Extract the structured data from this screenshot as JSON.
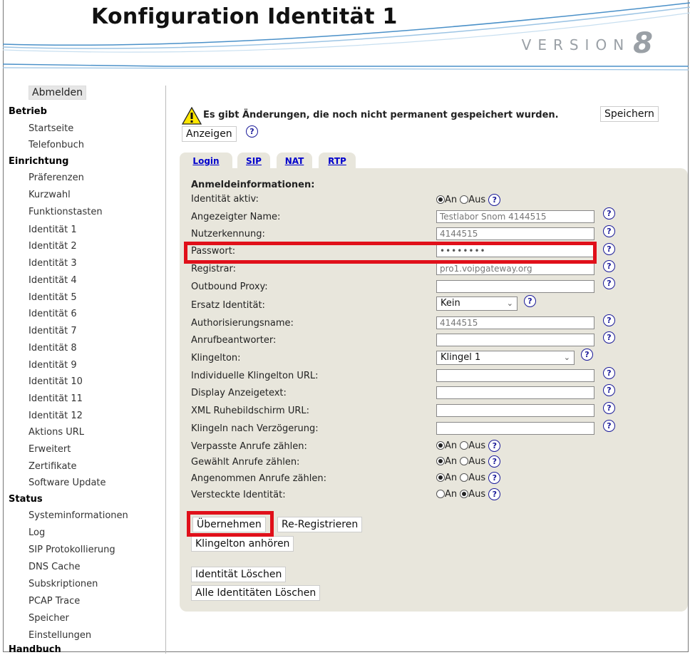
{
  "header": {
    "title": "Konfiguration Identität 1",
    "version_label": "VERSION",
    "version_number": "8"
  },
  "sidebar": {
    "logout": "Abmelden",
    "sections": [
      {
        "title": "Betrieb",
        "items": [
          "Startseite",
          "Telefonbuch"
        ]
      },
      {
        "title": "Einrichtung",
        "items": [
          "Präferenzen",
          "Kurzwahl",
          "Funktionstasten",
          "Identität 1",
          "Identität 2",
          "Identität 3",
          "Identität 4",
          "Identität 5",
          "Identität 6",
          "Identität 7",
          "Identität 8",
          "Identität 9",
          "Identität 10",
          "Identität 11",
          "Identität 12",
          "Aktions URL",
          "Erweitert",
          "Zertifikate",
          "Software Update"
        ]
      },
      {
        "title": "Status",
        "items": [
          "Systeminformationen",
          "Log",
          "SIP Protokollierung",
          "DNS Cache",
          "Subskriptionen",
          "PCAP Trace",
          "Speicher",
          "Einstellungen"
        ]
      },
      {
        "title": "Handbuch",
        "items": []
      }
    ]
  },
  "warning": {
    "text": "Es gibt Änderungen, die noch nicht permanent gespeichert wurden.",
    "save_button": "Speichern",
    "show_button": "Anzeigen"
  },
  "tabs": [
    "Login",
    "SIP",
    "NAT",
    "RTP"
  ],
  "form": {
    "section_title": "Anmeldeinformationen:",
    "radio_on": "An",
    "radio_off": "Aus",
    "fields": {
      "identity_active": {
        "label": "Identität aktiv:",
        "value": "An"
      },
      "display_name": {
        "label": "Angezeigter Name:",
        "value": "Testlabor Snom 4144515"
      },
      "user_id": {
        "label": "Nutzerkennung:",
        "value": "4144515"
      },
      "password": {
        "label": "Passwort:",
        "value": "••••••••"
      },
      "registrar": {
        "label": "Registrar:",
        "value": "pro1.voipgateway.org"
      },
      "outbound_proxy": {
        "label": "Outbound Proxy:",
        "value": ""
      },
      "failover_identity": {
        "label": "Ersatz Identität:",
        "value": "Kein"
      },
      "auth_name": {
        "label": "Authorisierungsname:",
        "value": "4144515"
      },
      "mailbox": {
        "label": "Anrufbeantworter:",
        "value": ""
      },
      "ringtone": {
        "label": "Klingelton:",
        "value": "Klingel 1"
      },
      "custom_ringtone_url": {
        "label": "Individuelle Klingelton URL:",
        "value": ""
      },
      "display_text": {
        "label": "Display Anzeigetext:",
        "value": ""
      },
      "xml_idle_url": {
        "label": "XML Ruhebildschirm URL:",
        "value": ""
      },
      "ring_delay": {
        "label": "Klingeln nach Verzögerung:",
        "value": ""
      },
      "count_missed": {
        "label": "Verpasste Anrufe zählen:",
        "value": "An"
      },
      "count_dialed": {
        "label": "Gewählt Anrufe zählen:",
        "value": "An"
      },
      "count_accepted": {
        "label": "Angenommen Anrufe zählen:",
        "value": "An"
      },
      "hidden_identity": {
        "label": "Versteckte Identität:",
        "value": "Aus"
      }
    }
  },
  "buttons": {
    "apply": "Übernehmen",
    "reregister": "Re-Registrieren",
    "play_ringtone": "Klingelton anhören",
    "delete_identity": "Identität Löschen",
    "delete_all": "Alle Identitäten Löschen"
  },
  "help_symbol": "?",
  "colors": {
    "highlight": "#e0101a",
    "panel": "#e8e6dc",
    "link": "#0000cc"
  }
}
